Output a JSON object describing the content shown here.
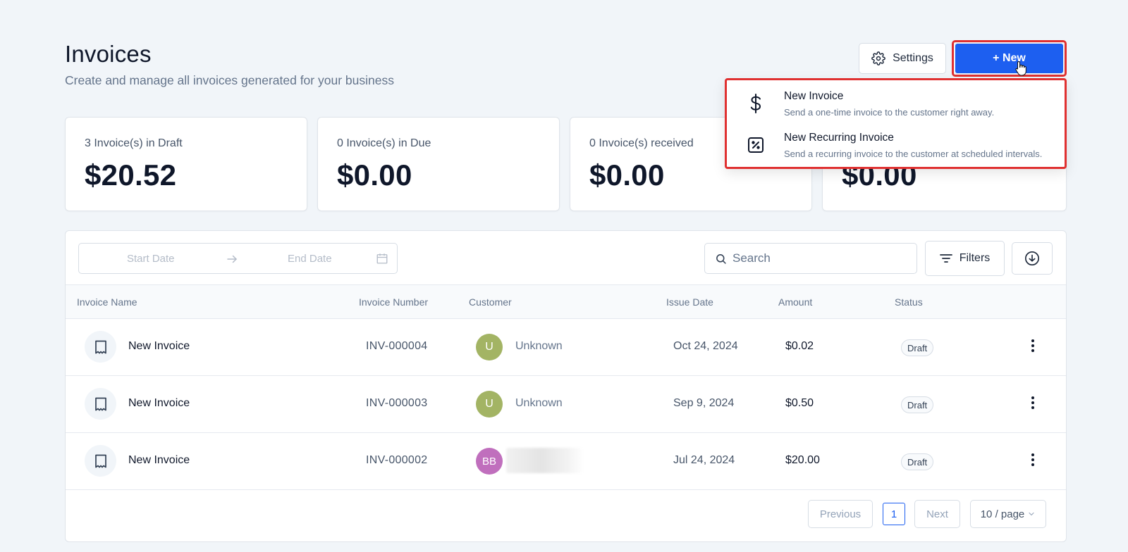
{
  "header": {
    "title": "Invoices",
    "subtitle": "Create and manage all invoices generated for your business"
  },
  "toolbar": {
    "settings_label": "Settings",
    "new_label": "+ New"
  },
  "stats": [
    {
      "label": "3 Invoice(s) in Draft",
      "value": "$20.52"
    },
    {
      "label": "0 Invoice(s) in Due",
      "value": "$0.00"
    },
    {
      "label": "0 Invoice(s) received",
      "value": "$0.00"
    },
    {
      "label": "",
      "value": "$0.00"
    }
  ],
  "new_menu": {
    "items": [
      {
        "title": "New Invoice",
        "description": "Send a one-time invoice to the customer right away.",
        "icon": "dollar-icon"
      },
      {
        "title": "New Recurring Invoice",
        "description": "Send a recurring invoice to the customer at scheduled intervals.",
        "icon": "percent-square-icon"
      }
    ]
  },
  "filters": {
    "start_placeholder": "Start Date",
    "end_placeholder": "End Date",
    "search_placeholder": "Search",
    "filters_label": "Filters"
  },
  "table": {
    "columns": [
      "Invoice Name",
      "Invoice Number",
      "Customer",
      "Issue Date",
      "Amount",
      "Status"
    ],
    "rows": [
      {
        "name": "New Invoice",
        "number": "INV-000004",
        "avatar": "U",
        "avatar_color": "#a3b464",
        "customer": "Unknown",
        "date": "Oct 24, 2024",
        "amount": "$0.02",
        "status": "Draft"
      },
      {
        "name": "New Invoice",
        "number": "INV-000003",
        "avatar": "U",
        "avatar_color": "#a3b464",
        "customer": "Unknown",
        "date": "Sep 9, 2024",
        "amount": "$0.50",
        "status": "Draft"
      },
      {
        "name": "New Invoice",
        "number": "INV-000002",
        "avatar": "BB",
        "avatar_color": "#c06fbd",
        "customer": "",
        "date": "Jul 24, 2024",
        "amount": "$20.00",
        "status": "Draft"
      }
    ]
  },
  "pagination": {
    "prev_label": "Previous",
    "current_page": "1",
    "next_label": "Next",
    "page_size_label": "10 / page"
  },
  "colors": {
    "primary": "#1d5ff0",
    "highlight": "#e03131"
  }
}
